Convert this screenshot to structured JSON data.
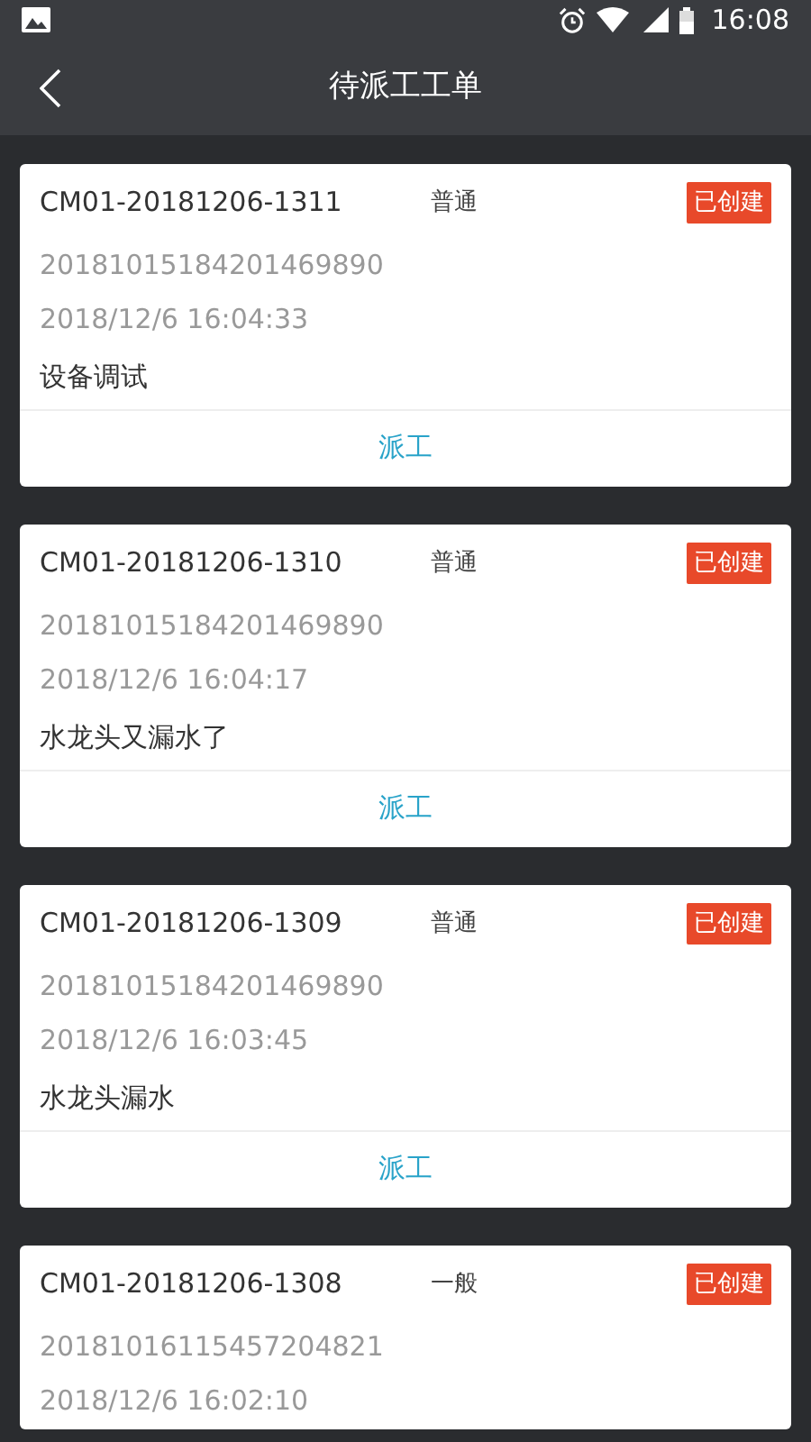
{
  "status_bar": {
    "time": "16:08"
  },
  "header": {
    "title": "待派工工单"
  },
  "orders": [
    {
      "code": "CM01-20181206-1311",
      "priority": "普通",
      "status": "已创建",
      "number": "20181015184201469890",
      "time": "2018/12/6 16:04:33",
      "description": "设备调试",
      "action": "派工"
    },
    {
      "code": "CM01-20181206-1310",
      "priority": "普通",
      "status": "已创建",
      "number": "20181015184201469890",
      "time": "2018/12/6 16:04:17",
      "description": "水龙头又漏水了",
      "action": "派工"
    },
    {
      "code": "CM01-20181206-1309",
      "priority": "普通",
      "status": "已创建",
      "number": "20181015184201469890",
      "time": "2018/12/6 16:03:45",
      "description": "水龙头漏水",
      "action": "派工"
    },
    {
      "code": "CM01-20181206-1308",
      "priority": "一般",
      "status": "已创建",
      "number": "20181016115457204821",
      "time": "2018/12/6 16:02:10"
    }
  ]
}
